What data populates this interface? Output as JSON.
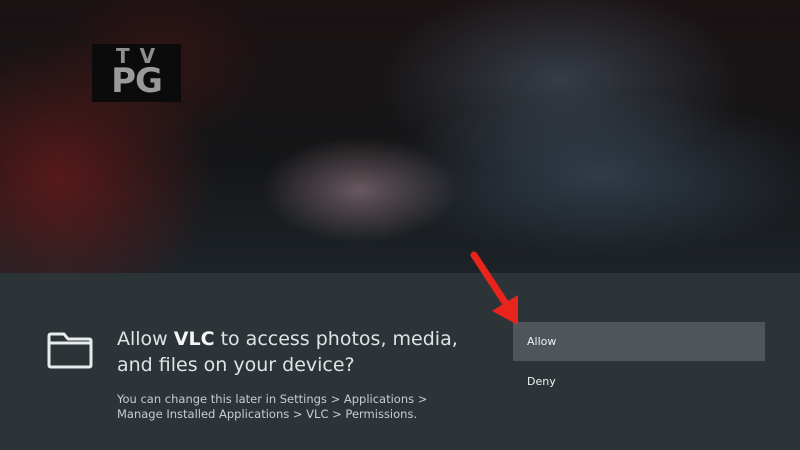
{
  "video": {
    "rating_badge": {
      "line1": "TV",
      "line2": "PG"
    }
  },
  "permission_dialog": {
    "icon": "folder-icon",
    "title_prefix": "Allow ",
    "app_name": "VLC",
    "title_suffix": " to access photos, media, and files on your device?",
    "description": "You can change this later in Settings > Applications > Manage Installed Applications > VLC > Permissions.",
    "buttons": {
      "allow": "Allow",
      "deny": "Deny"
    },
    "focused_option": "allow"
  },
  "annotation": {
    "icon": "red-arrow-icon",
    "color": "#e8241c"
  },
  "colors": {
    "dialog_background": "#2d3438",
    "focused_option": "#4f565b"
  }
}
